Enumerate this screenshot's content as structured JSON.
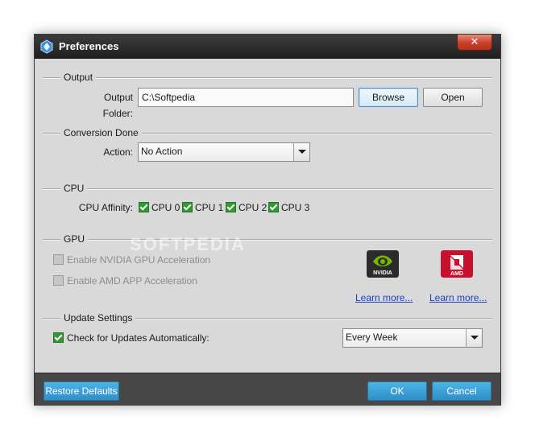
{
  "window": {
    "title": "Preferences",
    "close_glyph": "✕"
  },
  "output": {
    "heading": "Output",
    "folder_label": "Output Folder:",
    "folder_value": "C:\\Softpedia",
    "browse_label": "Browse",
    "open_label": "Open"
  },
  "conversion": {
    "heading": "Conversion Done",
    "action_label": "Action:",
    "action_value": "No Action"
  },
  "cpu": {
    "heading": "CPU",
    "affinity_label": "CPU Affinity:",
    "cores": [
      {
        "label": "CPU 0",
        "checked": true
      },
      {
        "label": "CPU 1",
        "checked": true
      },
      {
        "label": "CPU 2",
        "checked": true
      },
      {
        "label": "CPU 3",
        "checked": true
      }
    ]
  },
  "gpu": {
    "heading": "GPU",
    "nvidia_option": "Enable NVIDIA GPU Acceleration",
    "amd_option": "Enable AMD APP Acceleration",
    "nvidia_logo_text": "NVIDIA",
    "amd_logo_text": "AMD",
    "nvidia_learn_more": "Learn more...",
    "amd_learn_more": "Learn more..."
  },
  "updates": {
    "heading": "Update Settings",
    "auto_label": "Check for Updates Automatically:",
    "frequency_value": "Every Week"
  },
  "footer": {
    "restore_label": "Restore Defaults",
    "ok_label": "OK",
    "cancel_label": "Cancel"
  },
  "watermark": "SOFTPEDIA",
  "colors": {
    "titlebar": "#1f1f1f",
    "close": "#c8402a",
    "accent_button": "#2d8fc7",
    "checkbox_checked": "#2f9a2f",
    "nvidia": "#76b900",
    "amd": "#c8102e",
    "link": "#1a3fbf"
  }
}
